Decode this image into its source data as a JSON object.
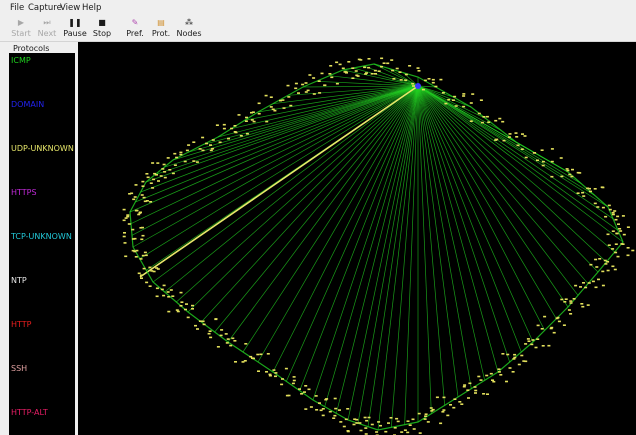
{
  "menu": [
    "File",
    "Capture",
    "View",
    "Help"
  ],
  "toolbar": [
    {
      "label": "Start",
      "icon": "play-icon",
      "enabled": false
    },
    {
      "label": "Next",
      "icon": "next-icon",
      "enabled": false
    },
    {
      "label": "Pause",
      "icon": "pause-icon",
      "enabled": true
    },
    {
      "label": "Stop",
      "icon": "stop-icon",
      "enabled": true
    },
    {
      "label": "Pref.",
      "icon": "preferences-icon",
      "enabled": true
    },
    {
      "label": "Prot.",
      "icon": "protocols-icon",
      "enabled": true
    },
    {
      "label": "Nodes",
      "icon": "nodes-icon",
      "enabled": true
    }
  ],
  "sidebar": {
    "title": "Protocols",
    "protocols": [
      {
        "name": "ICMP",
        "color": "#1fd11f"
      },
      {
        "name": "DOMAIN",
        "color": "#2222ee"
      },
      {
        "name": "UDP-UNKNOWN",
        "color": "#e6e66a"
      },
      {
        "name": "HTTPS",
        "color": "#c02ad8"
      },
      {
        "name": "TCP-UNKNOWN",
        "color": "#22c8d8"
      },
      {
        "name": "NTP",
        "color": "#e8e8e8"
      },
      {
        "name": "HTTP",
        "color": "#e81e1e"
      },
      {
        "name": "SSH",
        "color": "#e0a0a0"
      },
      {
        "name": "HTTP-ALT",
        "color": "#e81e66"
      }
    ]
  },
  "colors": {
    "node": "#e3e05c",
    "link": "#22d022",
    "highlight_link": "#e8e86a",
    "hub": "#3a3aff",
    "background": "#000000"
  }
}
